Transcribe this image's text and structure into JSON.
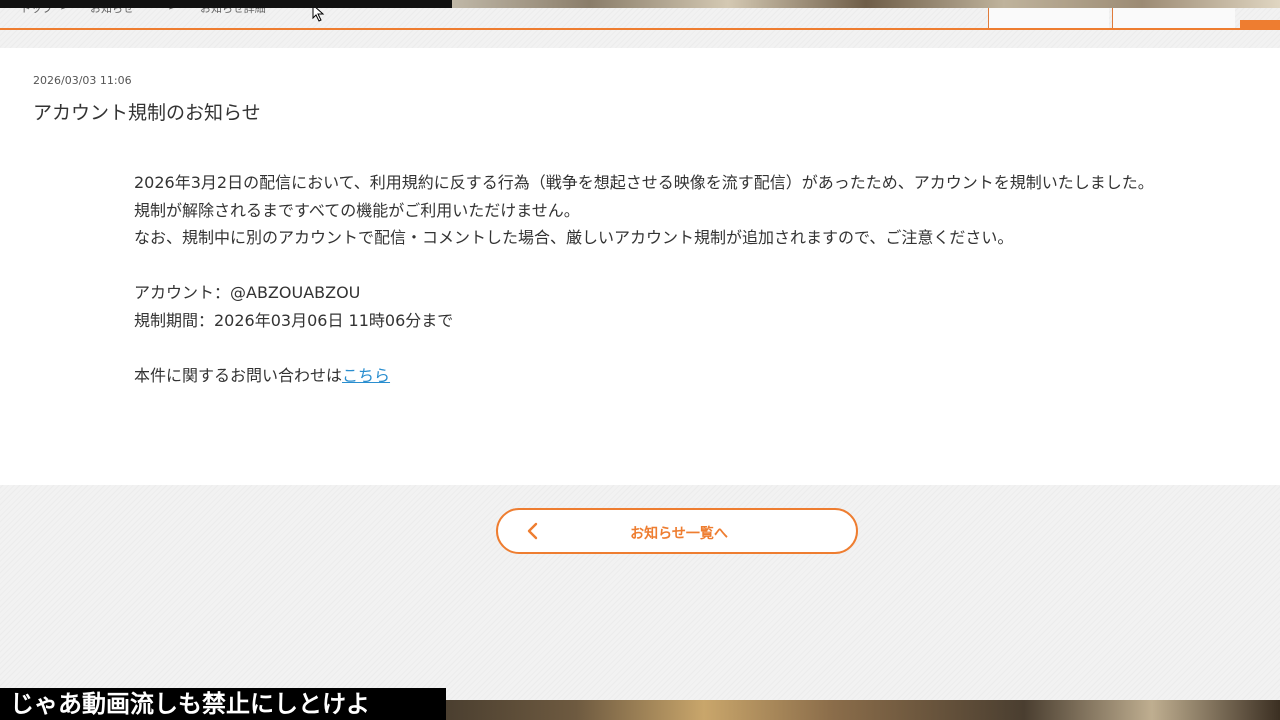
{
  "breadcrumb": {
    "items": [
      "トップ",
      "お知らせ",
      "お知らせ詳細"
    ],
    "separator": ">"
  },
  "notice": {
    "date": "2026/03/03 11:06",
    "title": "アカウント規制のお知らせ",
    "paragraph1": "2026年3月2日の配信において、利用規約に反する行為（戦争を想起させる映像を流す配信）があったため、アカウントを規制いたしました。",
    "paragraph2": "規制が解除されるまですべての機能がご利用いただけません。",
    "paragraph3": "なお、規制中に別のアカウントで配信・コメントした場合、厳しいアカウント規制が追加されますので、ご注意ください。",
    "account_line": "アカウント：@ABZOUABZOU",
    "period_line": "規制期間：2026年03月06日 11時06分まで",
    "contact_prefix": "本件に関するお問い合わせは",
    "contact_link": "こちら"
  },
  "back_button": {
    "label": "お知らせ一覧へ"
  },
  "overlay": {
    "subtitle": "じゃあ動画流しも禁止にしとけよ"
  },
  "colors": {
    "accent": "#ee7d30",
    "link": "#2a8ecf",
    "text": "#333333"
  },
  "icons": {
    "back": "chevron-left-icon",
    "cursor": "mouse-cursor-icon"
  }
}
